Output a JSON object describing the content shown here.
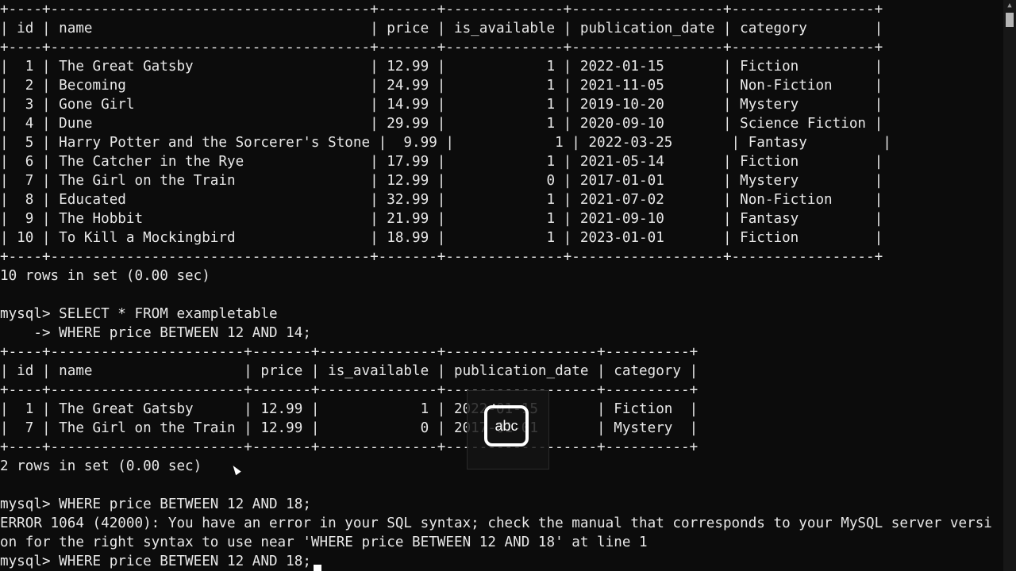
{
  "terminal": {
    "lines": [
      "+----+--------------------------------------+-------+--------------+------------------+-----------------+",
      "| id | name                                 | price | is_available | publication_date | category        |",
      "+----+--------------------------------------+-------+--------------+------------------+-----------------+",
      "|  1 | The Great Gatsby                     | 12.99 |            1 | 2022-01-15       | Fiction         |",
      "|  2 | Becoming                             | 24.99 |            1 | 2021-11-05       | Non-Fiction     |",
      "|  3 | Gone Girl                            | 14.99 |            1 | 2019-10-20       | Mystery         |",
      "|  4 | Dune                                 | 29.99 |            1 | 2020-09-10       | Science Fiction |",
      "|  5 | Harry Potter and the Sorcerer's Stone |  9.99 |            1 | 2022-03-25       | Fantasy         |",
      "|  6 | The Catcher in the Rye               | 17.99 |            1 | 2021-05-14       | Fiction         |",
      "|  7 | The Girl on the Train                | 12.99 |            0 | 2017-01-01       | Mystery         |",
      "|  8 | Educated                             | 32.99 |            1 | 2021-07-02       | Non-Fiction     |",
      "|  9 | The Hobbit                           | 21.99 |            1 | 2021-09-10       | Fantasy         |",
      "| 10 | To Kill a Mockingbird                | 18.99 |            1 | 2023-01-01       | Fiction         |",
      "+----+--------------------------------------+-------+--------------+------------------+-----------------+",
      "10 rows in set (0.00 sec)",
      "",
      "mysql> SELECT * FROM exampletable",
      "    -> WHERE price BETWEEN 12 AND 14;",
      "+----+-----------------------+-------+--------------+------------------+----------+",
      "| id | name                  | price | is_available | publication_date | category |",
      "+----+-----------------------+-------+--------------+------------------+----------+",
      "|  1 | The Great Gatsby      | 12.99 |            1 | 2022-01-15       | Fiction  |",
      "|  7 | The Girl on the Train | 12.99 |            0 | 2017-01-01       | Mystery  |",
      "+----+-----------------------+-------+--------------+------------------+----------+",
      "2 rows in set (0.00 sec)",
      "",
      "mysql> WHERE price BETWEEN 12 AND 18;",
      "ERROR 1064 (42000): You have an error in your SQL syntax; check the manual that corresponds to your MySQL server versi",
      "on for the right syntax to use near 'WHERE price BETWEEN 12 AND 18' at line 1",
      "mysql> WHERE price BETWEEN 12 AND 18;"
    ]
  },
  "ime_indicator": {
    "label": "abc",
    "caret": "^"
  },
  "colors": {
    "background": "#0c0c0c",
    "text": "#e8e8e8"
  }
}
